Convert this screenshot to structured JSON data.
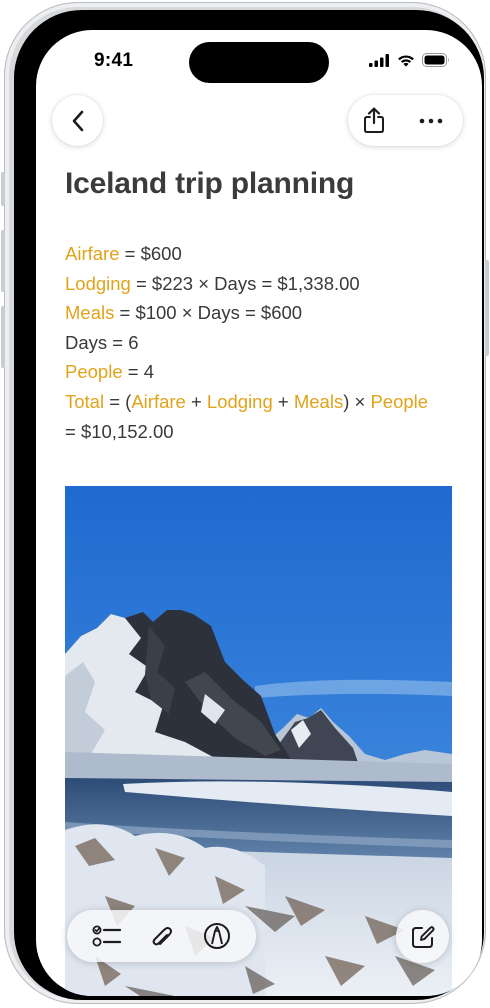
{
  "status_bar": {
    "time": "9:41",
    "icons": [
      "cellular-signal-icon",
      "wifi-icon",
      "battery-icon"
    ]
  },
  "nav": {
    "back_icon": "chevron-left-icon",
    "share_icon": "share-icon",
    "more_icon": "ellipsis-icon"
  },
  "note": {
    "title": "Iceland trip planning",
    "lines": [
      [
        {
          "t": "Airfare",
          "v": true
        },
        {
          "t": " = $600",
          "v": false
        }
      ],
      [
        {
          "t": "Lodging",
          "v": true
        },
        {
          "t": " = $223 × Days = $1,338.00",
          "v": false
        }
      ],
      [
        {
          "t": "Meals",
          "v": true
        },
        {
          "t": " = $100 × Days = $600",
          "v": false
        }
      ],
      [
        {
          "t": "Days = 6",
          "v": false
        }
      ],
      [
        {
          "t": "People",
          "v": true
        },
        {
          "t": " = 4",
          "v": false
        }
      ],
      [
        {
          "t": "Total",
          "v": true
        },
        {
          "t": " = (",
          "v": false
        },
        {
          "t": "Airfare",
          "v": true
        },
        {
          "t": " + ",
          "v": false
        },
        {
          "t": "Lodging",
          "v": true
        },
        {
          "t": " + ",
          "v": false
        },
        {
          "t": "Meals",
          "v": true
        },
        {
          "t": ") × ",
          "v": false
        },
        {
          "t": "People",
          "v": true
        }
      ],
      [
        {
          "t": "= $10,152.00",
          "v": false
        }
      ]
    ],
    "image": "mountain-landscape-photo"
  },
  "toolbar": {
    "checklist_icon": "checklist-icon",
    "attachment_icon": "paperclip-icon",
    "markup_icon": "markup-pen-icon",
    "compose_icon": "compose-icon"
  },
  "colors": {
    "variable": "#e0a31a",
    "text": "#3a3a3c",
    "title": "#3b3b3d"
  }
}
